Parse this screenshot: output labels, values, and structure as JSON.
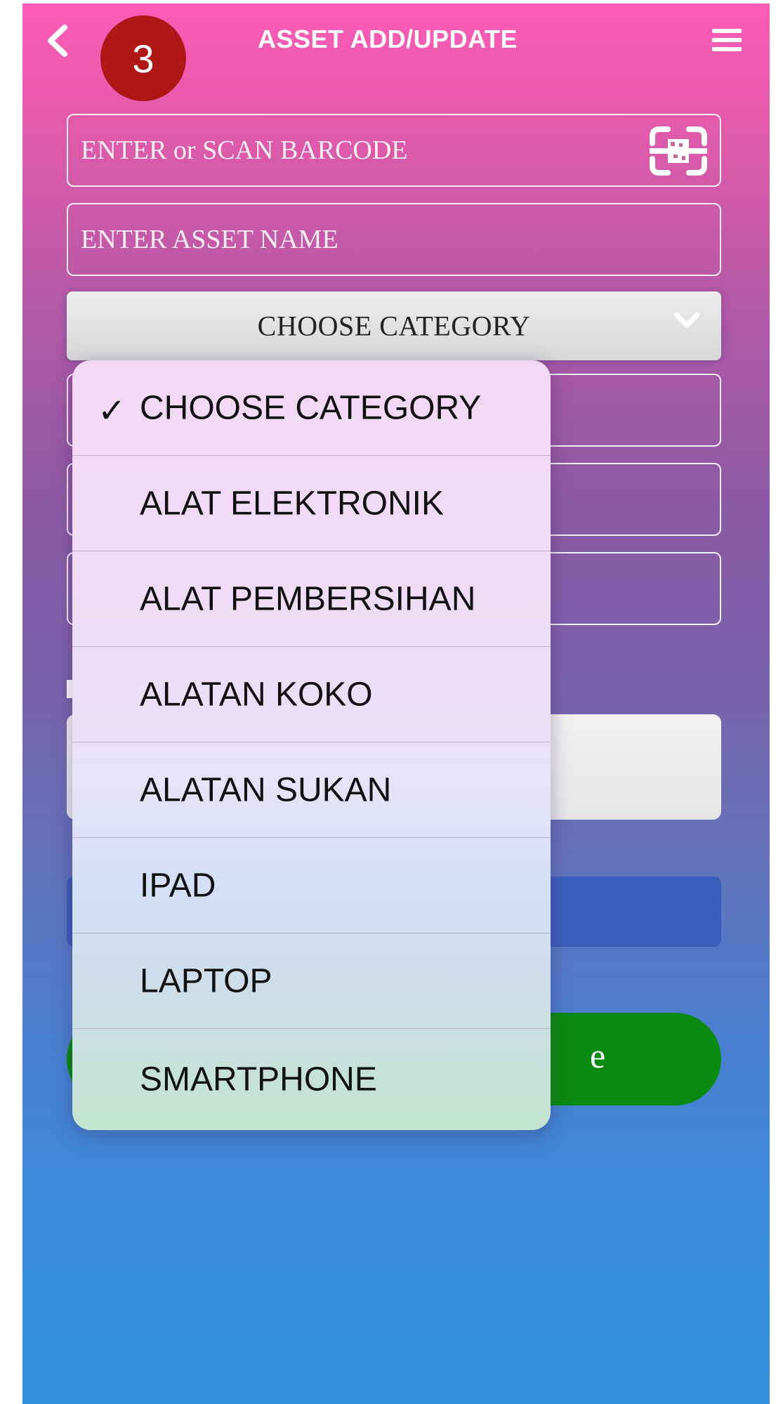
{
  "header": {
    "title": "ASSET ADD/UPDATE",
    "step_number": "3",
    "back_icon": "chevron-left-icon",
    "menu_icon": "hamburger-menu-icon"
  },
  "form": {
    "barcode_placeholder": "ENTER or SCAN BARCODE",
    "barcode_icon": "qr-scan-icon",
    "asset_name_placeholder": "ENTER ASSET NAME",
    "category_selected": "CHOOSE CATEGORY",
    "category_icon": "chevron-down-icon",
    "submit_partial_text": "e"
  },
  "dropdown": {
    "options": [
      {
        "label": "CHOOSE CATEGORY",
        "selected": true
      },
      {
        "label": "ALAT ELEKTRONIK",
        "selected": false
      },
      {
        "label": "ALAT PEMBERSIHAN",
        "selected": false
      },
      {
        "label": "ALATAN KOKO",
        "selected": false
      },
      {
        "label": "ALATAN SUKAN",
        "selected": false
      },
      {
        "label": "IPAD",
        "selected": false
      },
      {
        "label": "LAPTOP",
        "selected": false
      },
      {
        "label": "SMARTPHONE",
        "selected": false
      }
    ],
    "check_glyph": "✓"
  },
  "colors": {
    "gradient_top": "#fd5cb6",
    "gradient_bottom": "#2f8ed9",
    "badge": "#b01818",
    "blue_button": "#3a5fbb",
    "green_button": "#0a8a10"
  }
}
